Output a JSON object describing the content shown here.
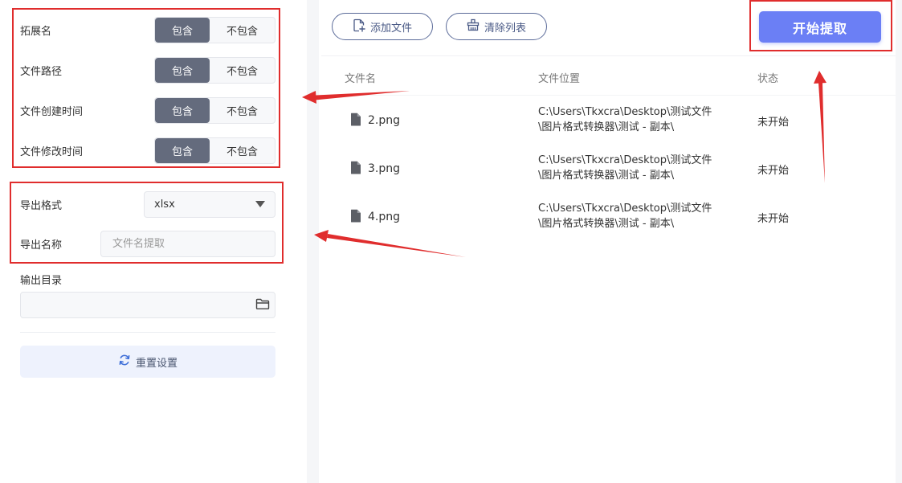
{
  "options": [
    {
      "label": "拓展名",
      "include": "包含",
      "exclude": "不包含",
      "selected": "include"
    },
    {
      "label": "文件路径",
      "include": "包含",
      "exclude": "不包含",
      "selected": "include"
    },
    {
      "label": "文件创建时间",
      "include": "包含",
      "exclude": "不包含",
      "selected": "include"
    },
    {
      "label": "文件修改时间",
      "include": "包含",
      "exclude": "不包含",
      "selected": "include"
    }
  ],
  "export": {
    "format_label": "导出格式",
    "format_value": "xlsx",
    "name_label": "导出名称",
    "name_placeholder": "文件名提取"
  },
  "output": {
    "dir_label": "输出目录",
    "dir_value": ""
  },
  "reset_label": "重置设置",
  "toolbar": {
    "add_label": "添加文件",
    "clear_label": "清除列表",
    "start_label": "开始提取"
  },
  "table": {
    "headers": [
      "文件名",
      "文件位置",
      "状态"
    ],
    "rows": [
      {
        "name": "2.png",
        "loc1": "C:\\Users\\Tkxcra\\Desktop\\测试文件",
        "loc2": "\\图片格式转换器\\测试 - 副本\\",
        "status": "未开始"
      },
      {
        "name": "3.png",
        "loc1": "C:\\Users\\Tkxcra\\Desktop\\测试文件",
        "loc2": "\\图片格式转换器\\测试 - 副本\\",
        "status": "未开始"
      },
      {
        "name": "4.png",
        "loc1": "C:\\Users\\Tkxcra\\Desktop\\测试文件",
        "loc2": "\\图片格式转换器\\测试 - 副本\\",
        "status": "未开始"
      }
    ]
  },
  "colors": {
    "accent": "#6b7ff5",
    "toggle_on": "#646b7d",
    "annotation": "#e02d2d"
  },
  "icons": [
    "add-file-icon",
    "clear-list-icon",
    "folder-icon",
    "refresh-icon",
    "file-icon",
    "dropdown-triangle-icon"
  ]
}
